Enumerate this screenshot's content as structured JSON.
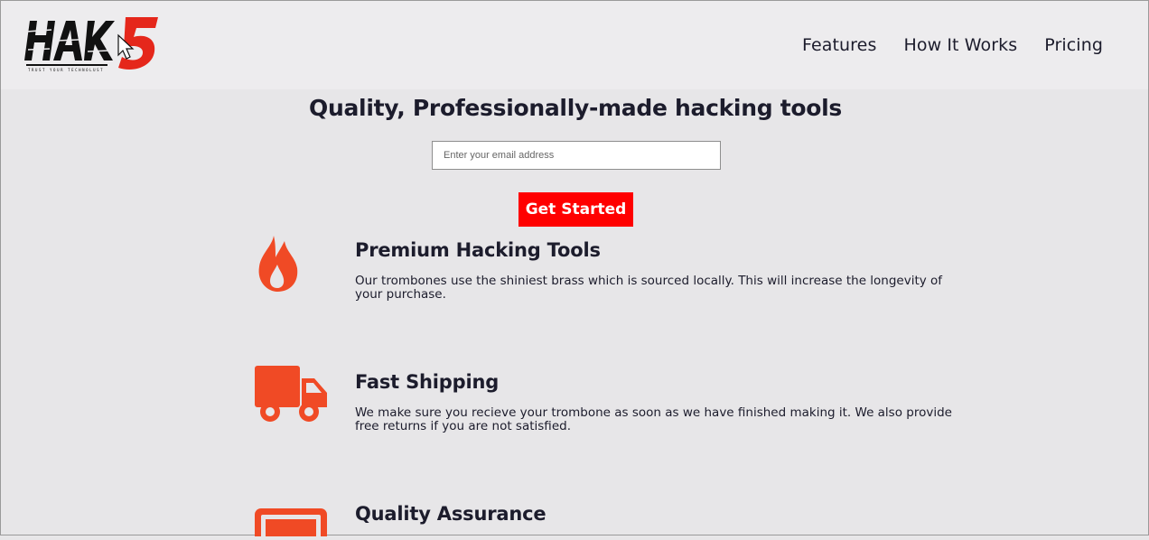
{
  "header": {
    "logo": {
      "text": "HAK5",
      "tagline": "TRUST YOUR TECHNOLUST",
      "icon": "cursor-arrow-icon"
    },
    "nav": [
      {
        "label": "Features"
      },
      {
        "label": "How It Works"
      },
      {
        "label": "Pricing"
      }
    ]
  },
  "hero": {
    "title": "Quality, Professionally-made hacking tools",
    "email_placeholder": "Enter your email address",
    "cta_label": "Get Started"
  },
  "features": [
    {
      "icon": "fire-icon",
      "title": "Premium Hacking Tools",
      "description": "Our trombones use the shiniest brass which is sourced locally. This will increase the longevity of your purchase."
    },
    {
      "icon": "truck-icon",
      "title": "Fast Shipping",
      "description": "We make sure you recieve your trombone as soon as we have finished making it. We also provide free returns if you are not satisfied."
    },
    {
      "icon": "battery-icon",
      "title": "Quality Assurance",
      "description": ""
    }
  ],
  "colors": {
    "accent": "#ff0000",
    "icon": "#f04a25",
    "text": "#1c1c2c",
    "background": "#e7e6e8",
    "header_background": "#edecee"
  }
}
